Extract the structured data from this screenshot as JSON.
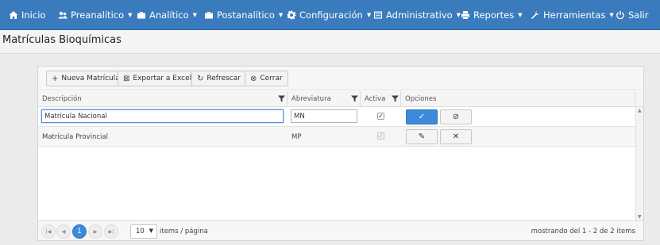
{
  "navbar": {
    "items": [
      {
        "label": "Inicio",
        "icon": "home-icon",
        "caret": false
      },
      {
        "label": "Preanalítico",
        "icon": "group-icon",
        "caret": true
      },
      {
        "label": "Analítico",
        "icon": "briefcase-icon",
        "caret": true
      },
      {
        "label": "Postanalítico",
        "icon": "briefcase-icon",
        "caret": true
      },
      {
        "label": "Configuración",
        "icon": "gear-icon",
        "caret": true
      },
      {
        "label": "Administrativo",
        "icon": "list-icon",
        "caret": true
      },
      {
        "label": "Reportes",
        "icon": "print-icon",
        "caret": true
      },
      {
        "label": "Herramientas",
        "icon": "wrench-icon",
        "caret": true
      },
      {
        "label": "Salir",
        "icon": "power-icon",
        "caret": false
      }
    ]
  },
  "page": {
    "title": "Matrículas Bioquímicas"
  },
  "toolbar": {
    "new_label": "Nueva Matrícula",
    "excel_label": "Exportar a Excel",
    "refresh_label": "Refrescar",
    "close_label": "Cerrar"
  },
  "columns": {
    "descripcion": "Descripción",
    "abreviatura": "Abreviatura",
    "activa": "Activa",
    "opciones": "Opciones"
  },
  "rows": [
    {
      "descripcion": "Matrícula Nacional",
      "abreviatura": "MN",
      "activa": true,
      "editing": true
    },
    {
      "descripcion": "Matrícula Provincial",
      "abreviatura": "MP",
      "activa": true,
      "editing": false
    }
  ],
  "pager": {
    "current_page": "1",
    "page_size": "10",
    "page_size_label": "items / página",
    "summary": "mostrando del 1 - 2 de 2 items"
  },
  "colors": {
    "navbar": "#3a7bbd",
    "primary_button": "#3d8bdb"
  }
}
